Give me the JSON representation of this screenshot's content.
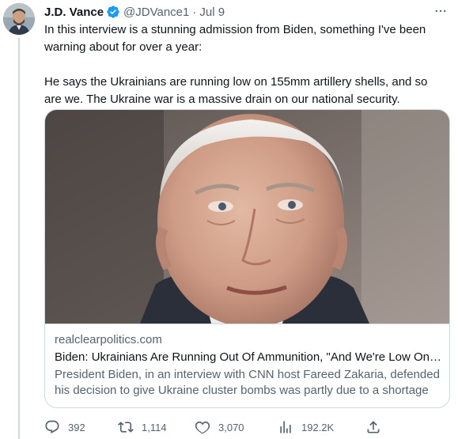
{
  "tweet": {
    "author_name": "J.D. Vance",
    "handle": "@JDVance1",
    "separator": "·",
    "date": "Jul 9",
    "text_paragraph_1": "In this interview is a stunning admission from Biden, something I've been warning about for over a year:",
    "text_paragraph_2": "He says the Ukrainians are running low on 155mm artillery shells, and so are we. The Ukraine war is a massive drain on our national security."
  },
  "card": {
    "domain": "realclearpolitics.com",
    "title": "Biden: Ukrainians Are Running Out Of Ammunition, \"And We're Low On It\"",
    "description": "President Biden, in an interview with CNN host Fareed Zakaria, defended his decision to give Ukraine cluster bombs was partly due to a shortage of munitions."
  },
  "actions": {
    "replies": "392",
    "reposts": "1,114",
    "likes": "3,070",
    "views": "192.2K"
  },
  "colors": {
    "text_primary": "#0f1419",
    "text_secondary": "#536471",
    "verified_blue": "#1d9bf0",
    "border": "#cfd9de"
  },
  "icons": {
    "verified": "verified-badge-icon",
    "more": "more-horizontal-icon",
    "reply": "reply-icon",
    "repost": "repost-icon",
    "like": "heart-icon",
    "views": "views-chart-icon",
    "share": "share-icon"
  }
}
